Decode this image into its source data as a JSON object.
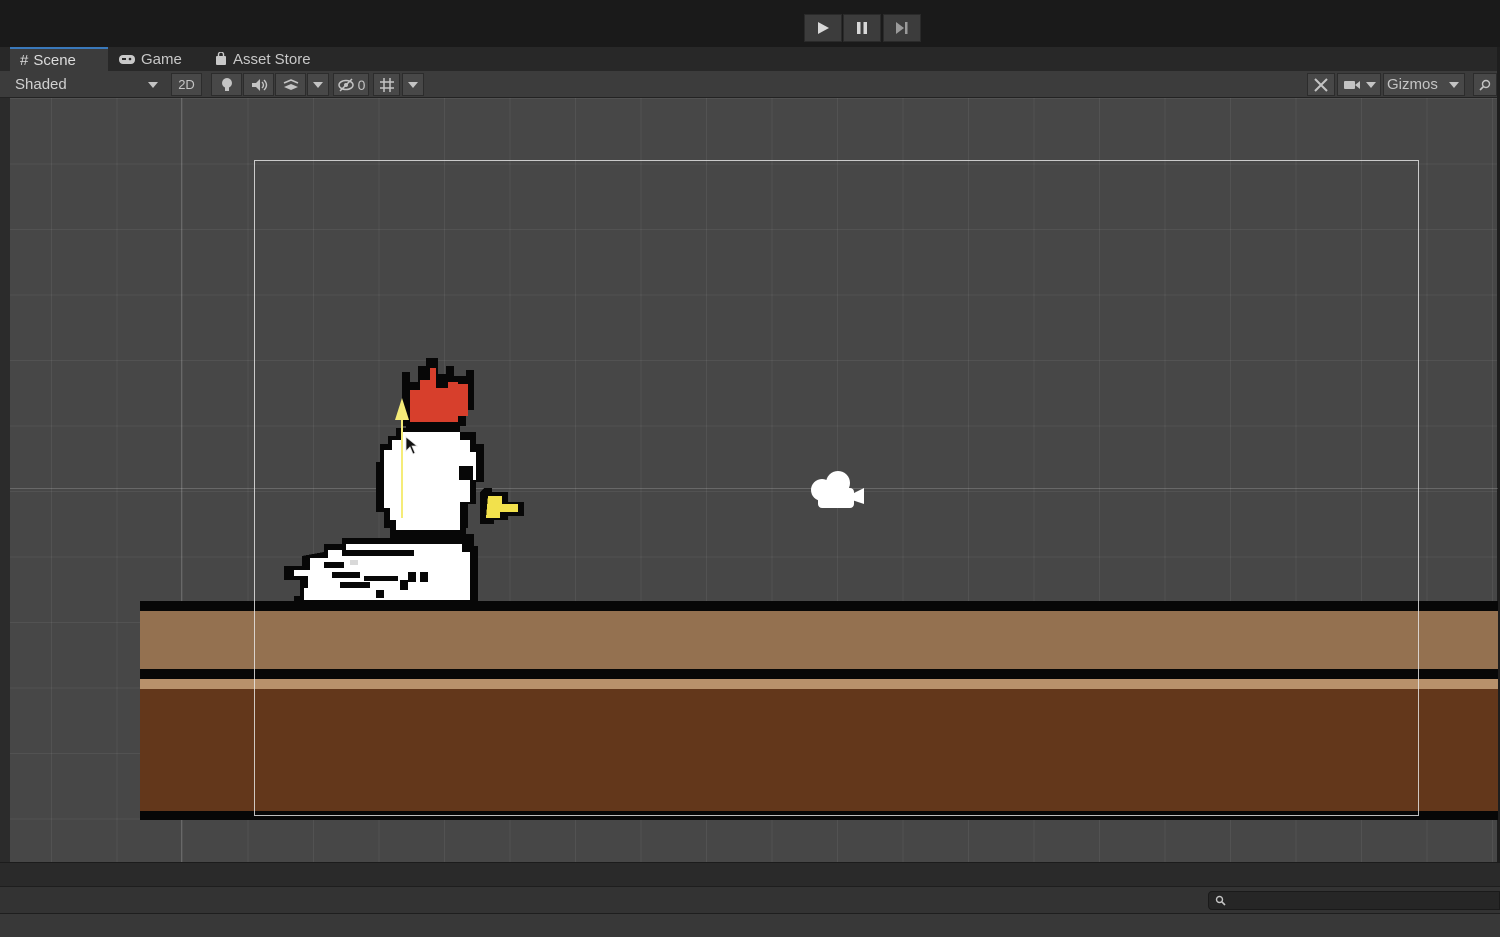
{
  "tabs": [
    {
      "label": "Scene",
      "icon": "hash-icon",
      "active": true
    },
    {
      "label": "Game",
      "icon": "gamepad-icon",
      "active": false
    },
    {
      "label": "Asset Store",
      "icon": "shopping-bag-icon",
      "active": false
    }
  ],
  "toolbar": {
    "shading_mode": "Shaded",
    "two_d_label": "2D",
    "hidden_count": "0",
    "gizmos_label": "Gizmos"
  },
  "colors": {
    "scene_bg": "#474747",
    "ground_top": "#947150",
    "ground_bottom": "#63371b",
    "crest": "#d73f2c",
    "beak": "#f2e14c",
    "move_arrow": "#f5ec78"
  },
  "icons": [
    "play-icon",
    "pause-icon",
    "step-icon",
    "lightbulb-icon",
    "audio-icon",
    "effects-icon",
    "visibility-icon",
    "grid-icon",
    "tools-icon",
    "camera-icon",
    "search-icon",
    "scene-camera-gizmo-icon"
  ]
}
